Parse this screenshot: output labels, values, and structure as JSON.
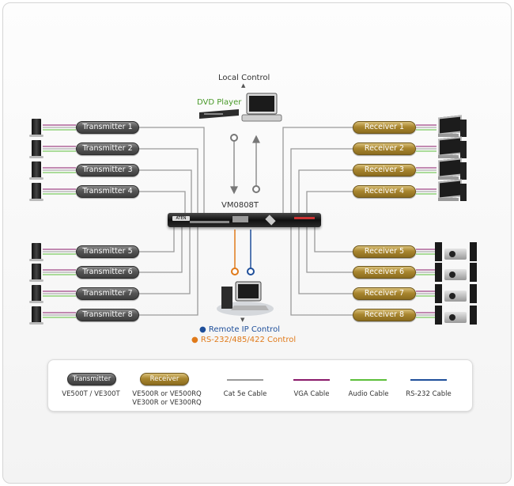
{
  "local_control": "Local Control",
  "dvd_player": "DVD Player",
  "switch_model": "VM0808T",
  "remote_ip": "Remote IP Control",
  "rs232_control": "RS-232/485/422 Control",
  "transmitters": [
    "Transmitter 1",
    "Transmitter 2",
    "Transmitter 3",
    "Transmitter 4",
    "Transmitter 5",
    "Transmitter 6",
    "Transmitter 7",
    "Transmitter 8"
  ],
  "receivers": [
    "Receiver 1",
    "Receiver 2",
    "Receiver 3",
    "Receiver 4",
    "Receiver 5",
    "Receiver 6",
    "Receiver 7",
    "Receiver 8"
  ],
  "legend": {
    "transmitter_badge": "Transmitter",
    "receiver_badge": "Receiver",
    "transmitter_models": "VE500T / VE300T",
    "receiver_models_1": "VE500R or VE500RQ",
    "receiver_models_2": "VE300R or VE300RQ",
    "cat5e": "Cat 5e Cable",
    "vga": "VGA Cable",
    "audio": "Audio Cable",
    "rs232": "RS-232 Cable"
  },
  "colors": {
    "cat5e": "#9a9a9a",
    "vga": "#8a1a6a",
    "audio": "#5cbf3a",
    "rs232": "#1f4f9a",
    "remote_ip_dot": "#1f4f9a",
    "rs232_text": "#e07a1a",
    "dvd_text": "#4a9a2a"
  }
}
